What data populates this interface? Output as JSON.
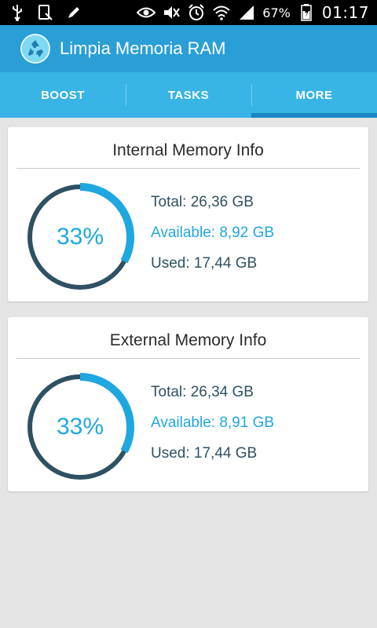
{
  "status_bar": {
    "battery_percent": "67%",
    "time": "01:17",
    "icons": [
      "usb-icon",
      "screenshot-icon",
      "pen-icon",
      "eye-icon",
      "mute-icon",
      "alarm-icon",
      "wifi-icon",
      "signal-icon",
      "battery-icon"
    ]
  },
  "app": {
    "title": "Limpia Memoria RAM"
  },
  "tabs": [
    {
      "label": "BOOST",
      "active": false
    },
    {
      "label": "TASKS",
      "active": false
    },
    {
      "label": "MORE",
      "active": true
    }
  ],
  "cards": [
    {
      "title": "Internal Memory Info",
      "percent_label": "33%",
      "used_fraction": 0.33,
      "total": "Total: 26,36 GB",
      "available": "Available: 8,92 GB",
      "used": "Used: 17,44 GB"
    },
    {
      "title": "External Memory Info",
      "percent_label": "33%",
      "used_fraction": 0.33,
      "total": "Total: 26,34 GB",
      "available": "Available: 8,91 GB",
      "used": "Used: 17,44 GB"
    }
  ],
  "colors": {
    "action_bar": "#2a9fd6",
    "tab_bar": "#38b4e6",
    "gauge_track": "#2f5162",
    "gauge_fill": "#1fa7e0"
  }
}
